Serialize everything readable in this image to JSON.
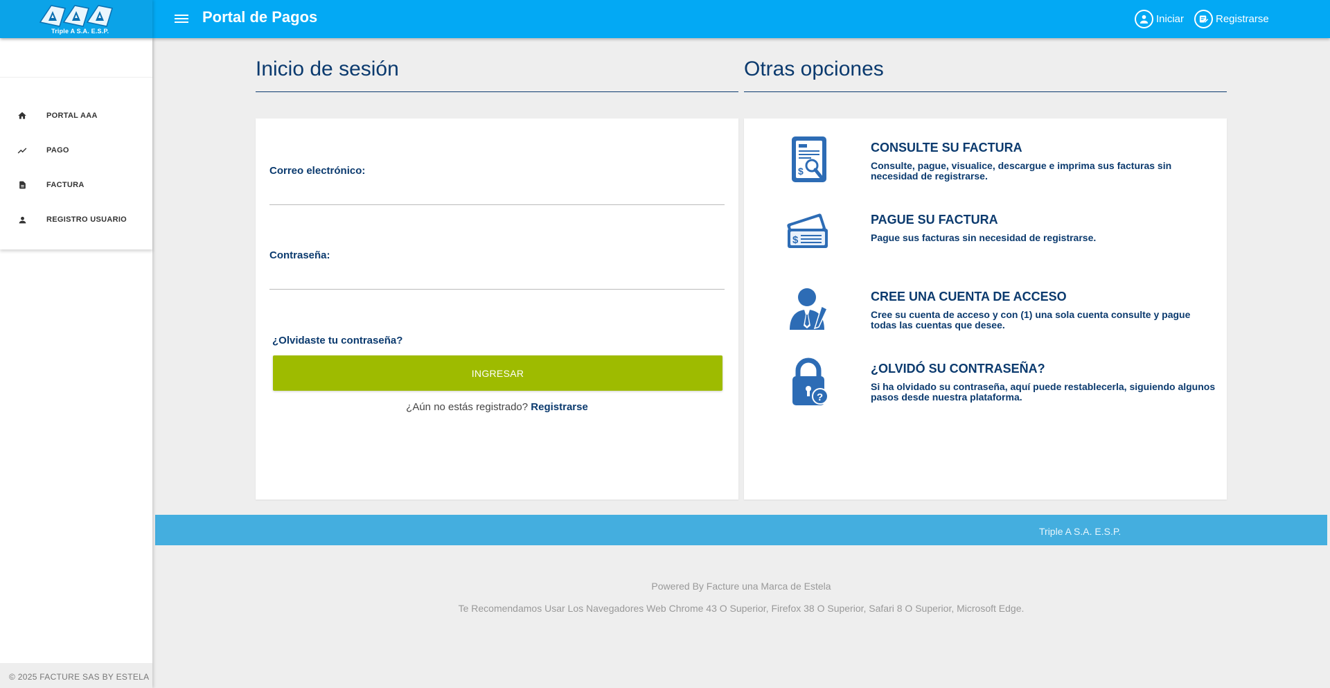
{
  "header": {
    "logo_text": "Triple A S.A. E.S.P.",
    "title": "Portal de Pagos",
    "login_link": "Iniciar",
    "register_link": "Registrarse",
    "bar_color": "#03a9f4"
  },
  "sidebar": {
    "items": [
      {
        "label": "PORTAL AAA",
        "icon": "home-icon"
      },
      {
        "label": "PAGO",
        "icon": "trending-icon"
      },
      {
        "label": "FACTURA",
        "icon": "document-icon"
      },
      {
        "label": "REGISTRO USUARIO",
        "icon": "person-icon"
      }
    ],
    "footer": "© 2025 FACTURE SAS BY ESTELA"
  },
  "login": {
    "section_title": "Inicio de sesión",
    "email_label": "Correo electrónico:",
    "email_value": "",
    "password_label": "Contraseña:",
    "password_value": "",
    "forgot_link": "¿Olvidaste tu contraseña?",
    "submit_label": "INGRESAR",
    "submit_color": "#9ebb00",
    "not_registered_text": "¿Aún no estás registrado?",
    "register_link": "Registrarse"
  },
  "options": {
    "section_title": "Otras opciones",
    "items": [
      {
        "title": "CONSULTE SU FACTURA",
        "desc": "Consulte, pague, visualice, descargue e imprima sus facturas sin necesidad de registrarse.",
        "icon": "invoice-search-icon"
      },
      {
        "title": "PAGUE SU FACTURA",
        "desc": "Pague sus facturas sin necesidad de registrarse.",
        "icon": "money-icon"
      },
      {
        "title": "CREE UNA CUENTA DE ACCESO",
        "desc": "Cree su cuenta de acceso y con (1) una sola cuenta consulte y pague todas las cuentas que desee.",
        "icon": "user-signup-icon"
      },
      {
        "title": "¿OLVIDÓ SU CONTRASEÑA?",
        "desc": "Si ha olvidado su contraseña, aquí puede restablecerla, siguiendo algunos pasos desde nuestra plataforma.",
        "icon": "lock-question-icon"
      }
    ]
  },
  "footer": {
    "band_text": "Triple A S.A. E.S.P.",
    "powered_by": "Powered By Facture una Marca de Estela",
    "browsers_note": "Te Recomendamos Usar Los Navegadores Web Chrome 43 O Superior, Firefox 38 O Superior, Safari 8 O Superior, Microsoft Edge.",
    "band_color": "#44aedf"
  }
}
